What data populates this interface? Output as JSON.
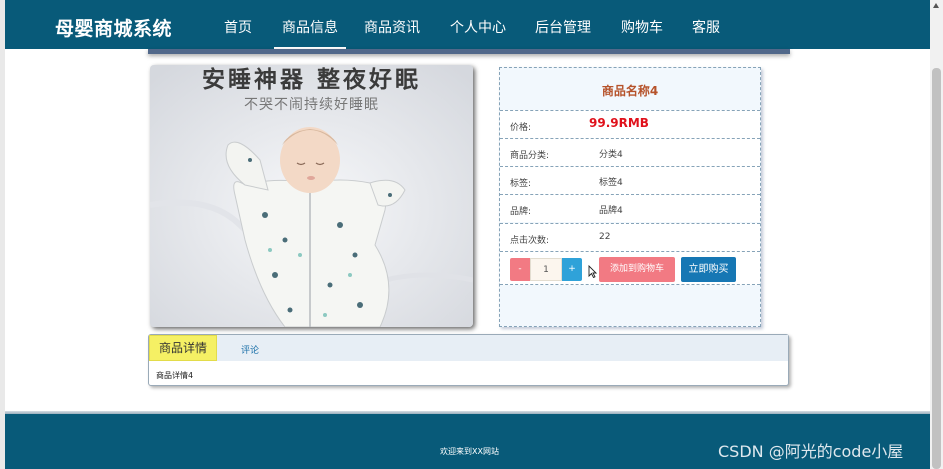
{
  "header": {
    "brand": "母婴商城系统",
    "nav": [
      "首页",
      "商品信息",
      "商品资讯",
      "个人中心",
      "后台管理",
      "购物车",
      "客服"
    ],
    "active_nav": "商品信息"
  },
  "product_image": {
    "headline": "安睡神器 整夜好眠",
    "subline": "不哭不闹持续好睡眠"
  },
  "product": {
    "name": "商品名称4",
    "price_label": "价格:",
    "price": "99.9RMB",
    "rows": [
      {
        "label": "商品分类:",
        "value": "分类4"
      },
      {
        "label": "标签:",
        "value": "标签4"
      },
      {
        "label": "品牌:",
        "value": "品牌4"
      },
      {
        "label": "点击次数:",
        "value": "22"
      }
    ]
  },
  "actions": {
    "minus": "-",
    "quantity": "1",
    "plus": "+",
    "add_to_cart": "添加到购物车",
    "buy_now": "立即购买"
  },
  "tabs": {
    "detail": "商品详情",
    "review": "评论",
    "detail_content": "商品详情4"
  },
  "footer": {
    "text": "欢迎来到XX网站"
  },
  "watermark": "CSDN @阿光的code小屋",
  "colors": {
    "nav_bg": "#085a79",
    "price": "#e0111b",
    "product_name": "#b6532b",
    "add_cart_btn": "#f27a83",
    "buy_btn": "#1677b4",
    "active_tab": "#f5f064"
  }
}
